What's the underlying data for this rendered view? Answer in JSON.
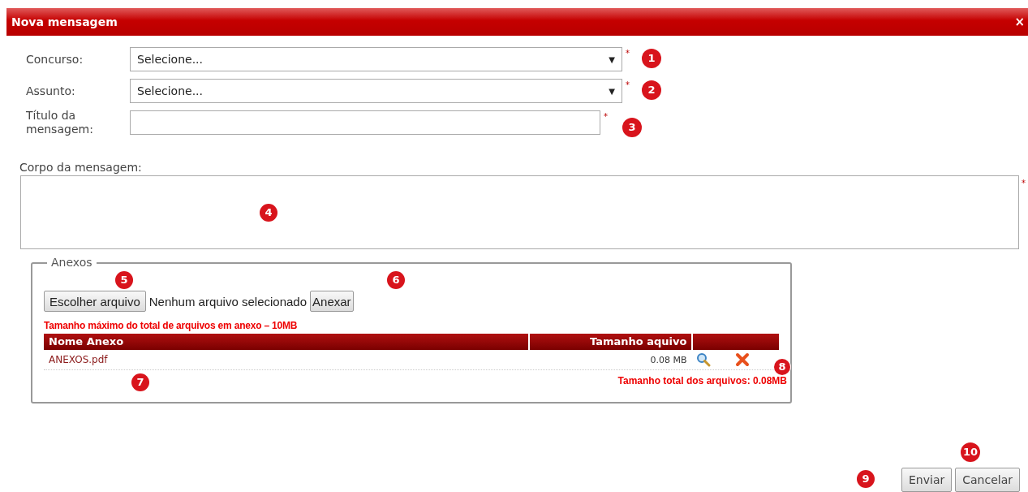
{
  "window": {
    "title": "Nova mensagem",
    "close": "×"
  },
  "fields": [
    {
      "kind": "select",
      "label": "Concurso:",
      "value": "Selecione...",
      "arrow": "▼",
      "required_mark": "*"
    },
    {
      "kind": "select",
      "label": "Assunto:",
      "value": "Selecione...",
      "arrow": "▼",
      "required_mark": "*"
    },
    {
      "kind": "text",
      "label": "Título da mensagem:",
      "required_mark": "*"
    }
  ],
  "body": {
    "label": "Corpo da mensagem:",
    "required_mark": "*"
  },
  "attachments": {
    "legend": "Anexos",
    "choose_button": "Escolher arquivo",
    "file_status": "Nenhum arquivo selecionado",
    "attach_button": "Anexar",
    "limit_note": "Tamanho máximo do total de arquivos em anexo – 10MB",
    "columns": [
      "Nome Anexo",
      "Tamanho aquivo"
    ],
    "rows": [
      {
        "name": "ANEXOS.pdf",
        "size": "0.08 MB"
      }
    ],
    "total": "Tamanho total dos arquivos: 0.08MB"
  },
  "buttons": [
    "Enviar",
    "Cancelar"
  ],
  "callouts": [
    {
      "label": "1"
    },
    {
      "label": "2"
    },
    {
      "label": "3"
    },
    {
      "label": "4"
    },
    {
      "label": "5"
    },
    {
      "label": "6"
    },
    {
      "label": "7"
    },
    {
      "label": "8"
    },
    {
      "label": "9"
    },
    {
      "label": "10"
    }
  ]
}
